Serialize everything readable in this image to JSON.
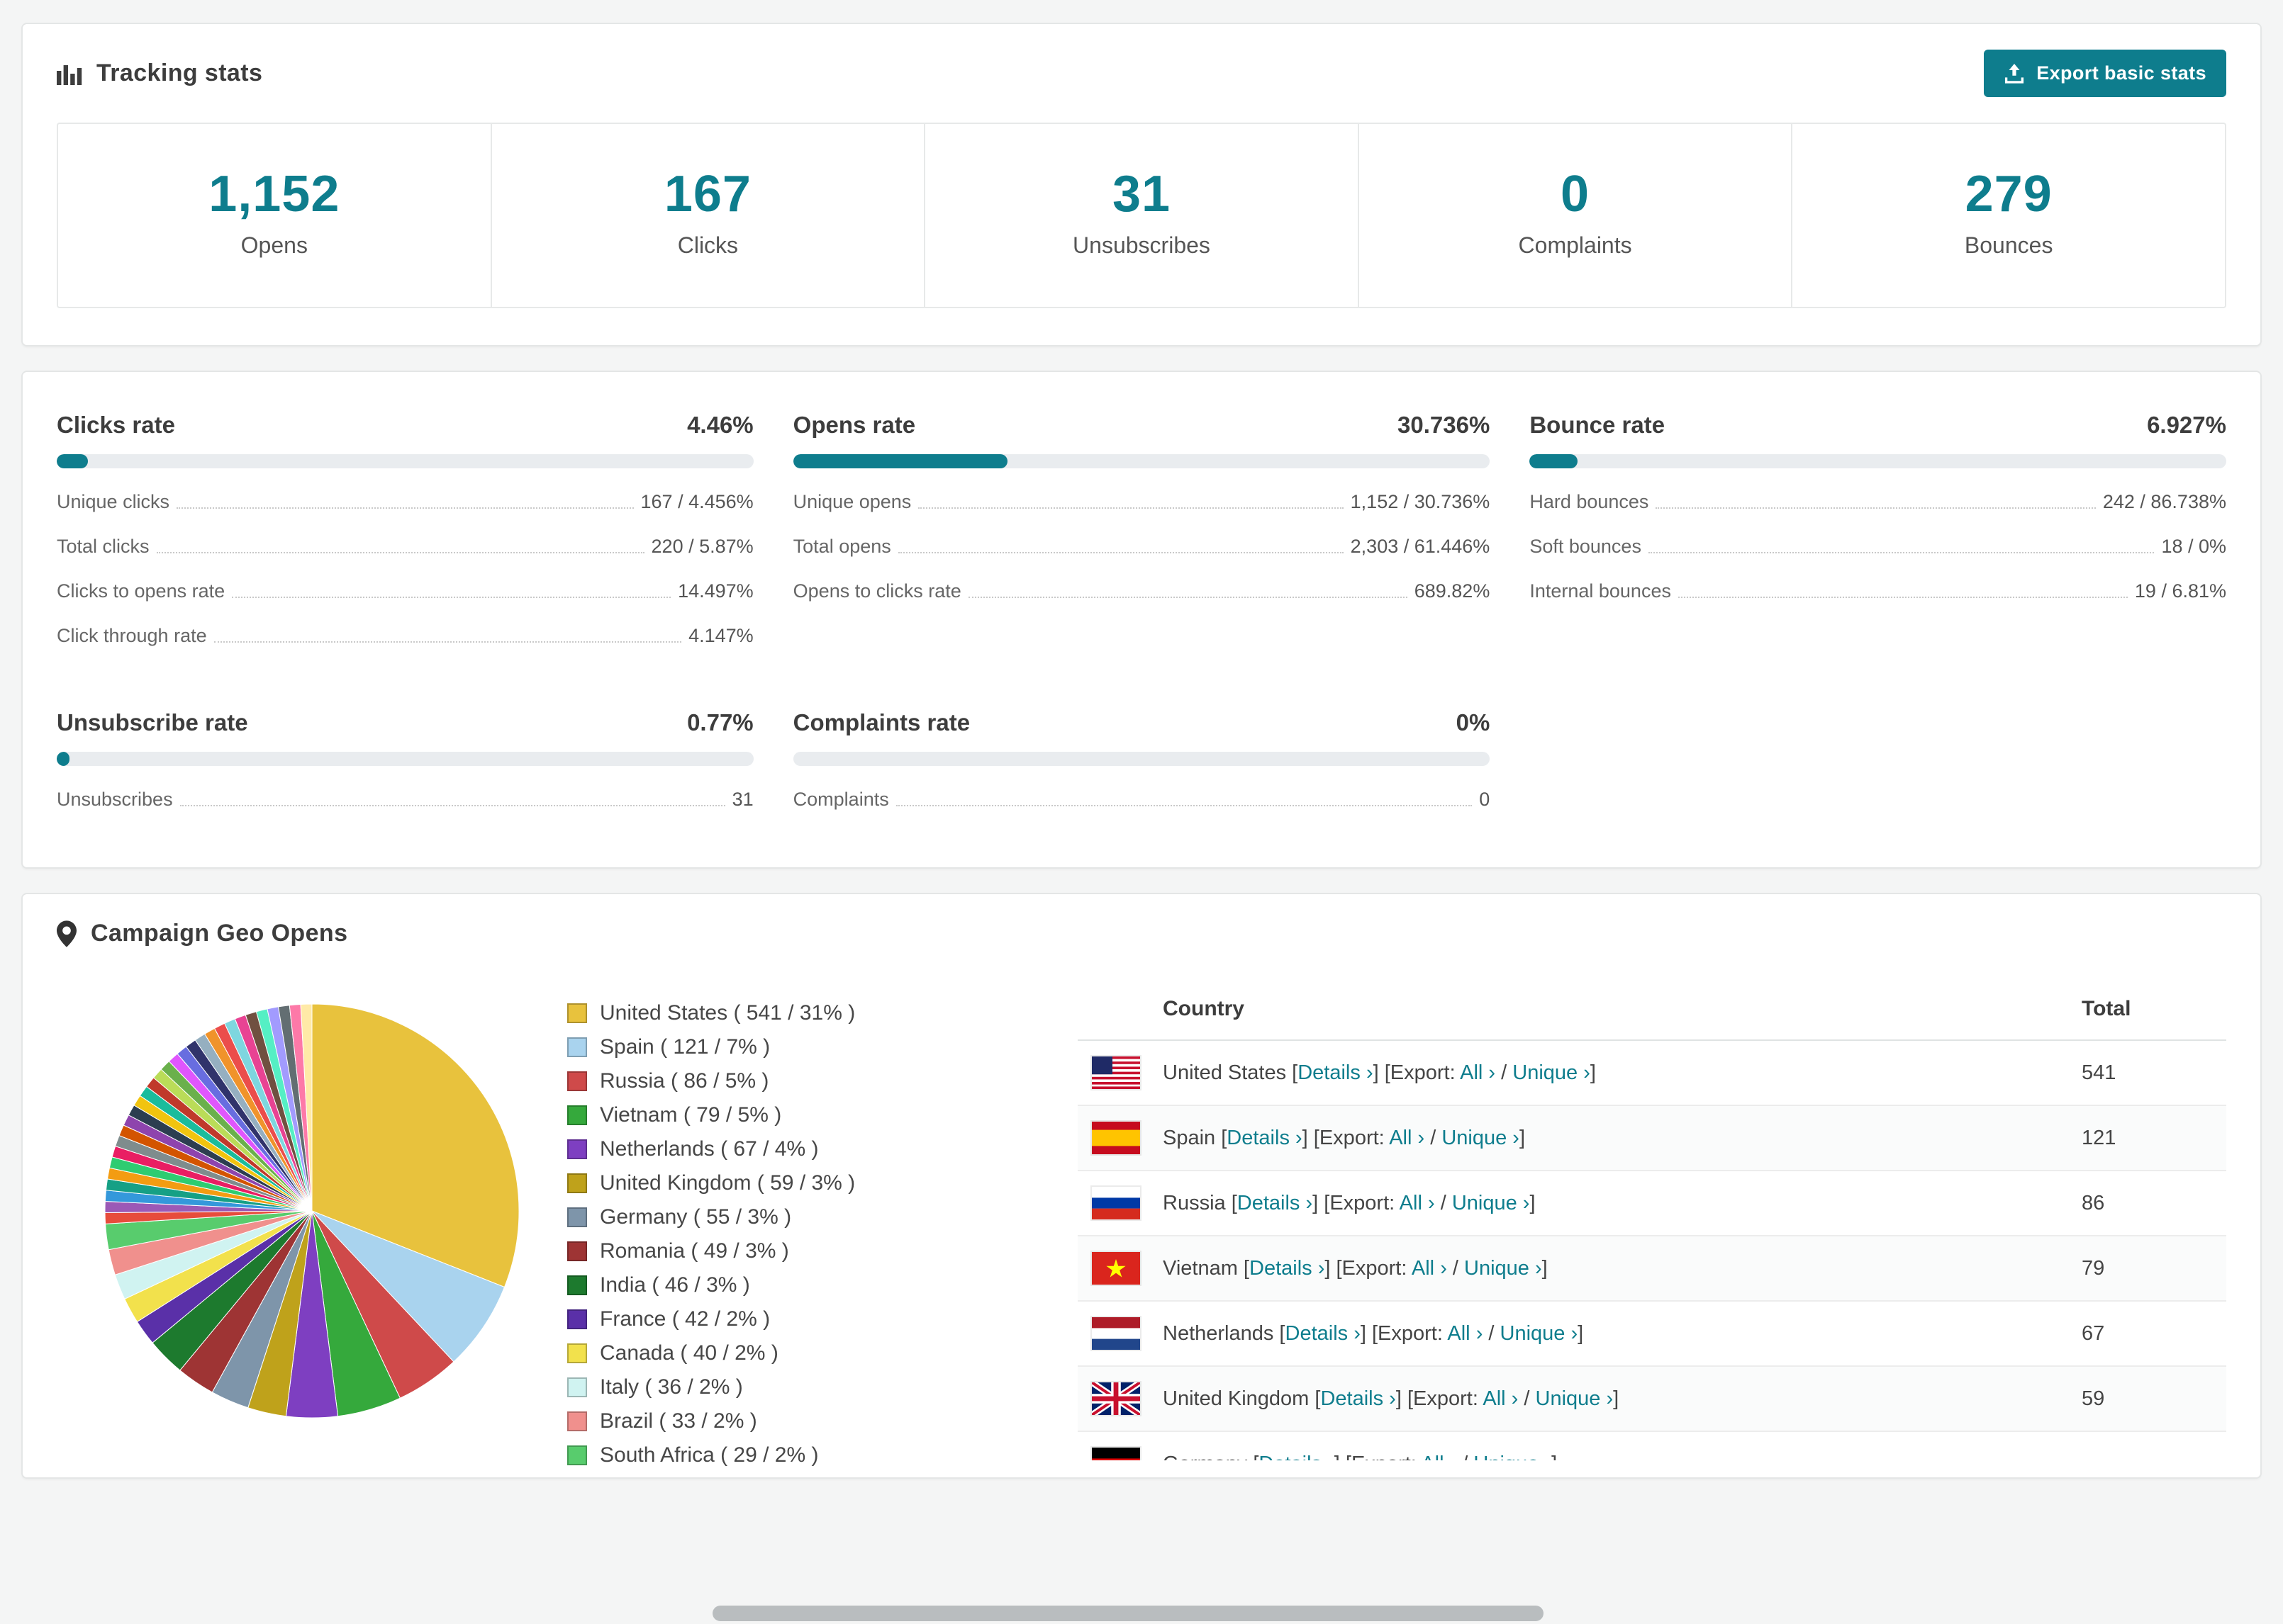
{
  "colors": {
    "accent": "#0e7d8d",
    "bar_track": "#e9ecef"
  },
  "tracking": {
    "title": "Tracking stats",
    "export_button": "Export basic stats",
    "stats": [
      {
        "value": "1,152",
        "label": "Opens"
      },
      {
        "value": "167",
        "label": "Clicks"
      },
      {
        "value": "31",
        "label": "Unsubscribes"
      },
      {
        "value": "0",
        "label": "Complaints"
      },
      {
        "value": "279",
        "label": "Bounces"
      }
    ]
  },
  "rates": [
    {
      "title": "Clicks rate",
      "value": "4.46%",
      "percent": 4.46,
      "rows": [
        {
          "label": "Unique clicks",
          "value": "167 / 4.456%"
        },
        {
          "label": "Total clicks",
          "value": "220 / 5.87%"
        },
        {
          "label": "Clicks to opens rate",
          "value": "14.497%"
        },
        {
          "label": "Click through rate",
          "value": "4.147%"
        }
      ]
    },
    {
      "title": "Opens rate",
      "value": "30.736%",
      "percent": 30.736,
      "rows": [
        {
          "label": "Unique opens",
          "value": "1,152 / 30.736%"
        },
        {
          "label": "Total opens",
          "value": "2,303 / 61.446%"
        },
        {
          "label": "Opens to clicks rate",
          "value": "689.82%"
        }
      ]
    },
    {
      "title": "Bounce rate",
      "value": "6.927%",
      "percent": 6.927,
      "rows": [
        {
          "label": "Hard bounces",
          "value": "242 / 86.738%"
        },
        {
          "label": "Soft bounces",
          "value": "18 / 0%"
        },
        {
          "label": "Internal bounces",
          "value": "19 / 6.81%"
        }
      ]
    },
    {
      "title": "Unsubscribe rate",
      "value": "0.77%",
      "percent": 0.77,
      "rows": [
        {
          "label": "Unsubscribes",
          "value": "31"
        }
      ]
    },
    {
      "title": "Complaints rate",
      "value": "0%",
      "percent": 0,
      "rows": [
        {
          "label": "Complaints",
          "value": "0"
        }
      ]
    }
  ],
  "geo": {
    "title": "Campaign Geo Opens",
    "legend": [
      {
        "label": "United States ( 541 / 31% )",
        "color": "#e8c23d"
      },
      {
        "label": "Spain ( 121 / 7% )",
        "color": "#a9d3ee"
      },
      {
        "label": "Russia ( 86 / 5% )",
        "color": "#cf4a4a"
      },
      {
        "label": "Vietnam ( 79 / 5% )",
        "color": "#35a93c"
      },
      {
        "label": "Netherlands ( 67 / 4% )",
        "color": "#7e3fc1"
      },
      {
        "label": "United Kingdom ( 59 / 3% )",
        "color": "#bfa21b"
      },
      {
        "label": "Germany ( 55 / 3% )",
        "color": "#7e95aa"
      },
      {
        "label": "Romania ( 49 / 3% )",
        "color": "#9e3434"
      },
      {
        "label": "India ( 46 / 3% )",
        "color": "#1d7a2e"
      },
      {
        "label": "France ( 42 / 2% )",
        "color": "#5a30a8"
      },
      {
        "label": "Canada ( 40 / 2% )",
        "color": "#f2e14c"
      },
      {
        "label": "Italy ( 36 / 2% )",
        "color": "#d0f3f1"
      },
      {
        "label": "Brazil ( 33 / 2% )",
        "color": "#f0908d"
      },
      {
        "label": "South Africa ( 29 / 2% )",
        "color": "#58cc6d"
      }
    ],
    "table": {
      "col_country": "Country",
      "col_total": "Total",
      "details_label": "Details",
      "export_label": "Export:",
      "all_label": "All",
      "unique_label": "Unique",
      "chevron": "›",
      "bracket_open": "[",
      "bracket_close": "]",
      "separator": "/",
      "rows": [
        {
          "country": "United States",
          "total": "541",
          "flag": "us"
        },
        {
          "country": "Spain",
          "total": "121",
          "flag": "es"
        },
        {
          "country": "Russia",
          "total": "86",
          "flag": "ru"
        },
        {
          "country": "Vietnam",
          "total": "79",
          "flag": "vn"
        },
        {
          "country": "Netherlands",
          "total": "67",
          "flag": "nl"
        },
        {
          "country": "United Kingdom",
          "total": "59",
          "flag": "gb"
        },
        {
          "country": "Germany",
          "total": "",
          "flag": "de",
          "partial": true
        }
      ]
    }
  },
  "chart_data": {
    "type": "pie",
    "title": "Campaign Geo Opens",
    "labels": [
      "United States",
      "Spain",
      "Russia",
      "Vietnam",
      "Netherlands",
      "United Kingdom",
      "Germany",
      "Romania",
      "India",
      "France",
      "Canada",
      "Italy",
      "Brazil",
      "South Africa"
    ],
    "values": [
      541,
      121,
      86,
      79,
      67,
      59,
      55,
      49,
      46,
      42,
      40,
      36,
      33,
      29
    ],
    "percents": [
      31,
      7,
      5,
      5,
      4,
      3,
      3,
      3,
      3,
      2,
      2,
      2,
      2,
      2
    ],
    "colors": [
      "#e8c23d",
      "#a9d3ee",
      "#cf4a4a",
      "#35a93c",
      "#7e3fc1",
      "#bfa21b",
      "#7e95aa",
      "#9e3434",
      "#1d7a2e",
      "#5a30a8",
      "#f2e14c",
      "#d0f3f1",
      "#f0908d",
      "#58cc6d"
    ],
    "others": {
      "note": "many small unlabeled slices",
      "percent_total": 26,
      "slice_colors": [
        "#e74c3c",
        "#9b59b6",
        "#3498db",
        "#16a085",
        "#f39c12",
        "#2ecc71",
        "#e91e63",
        "#7f8c8d",
        "#d35400",
        "#8e44ad",
        "#2c3e50",
        "#f1c40f",
        "#1abc9c",
        "#c0392b",
        "#badc58",
        "#6ab04c",
        "#e056fd",
        "#686de0",
        "#30336b",
        "#95afc0",
        "#f0932b",
        "#eb4d4b",
        "#7ed6df",
        "#e84393",
        "#705040",
        "#55efc4",
        "#a29bfe",
        "#636e72",
        "#fd79a8",
        "#ffeaa7"
      ]
    },
    "legend_position": "right",
    "start_angle_deg": -90,
    "direction": "clockwise"
  }
}
